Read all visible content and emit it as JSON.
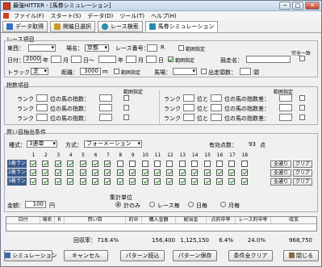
{
  "window": {
    "title": "最強HITTER - [馬券シミュレーション]",
    "minimize": "─",
    "maximize": "□",
    "close": "✕"
  },
  "menu": [
    "ファイル(F)",
    "スタート(S)",
    "データ(D)",
    "ツール(T)",
    "ヘルプ(H)"
  ],
  "tabs": [
    {
      "label": "データ取得",
      "color": "#3a70c0"
    },
    {
      "label": "開催日選択",
      "color": "#c89a2a"
    },
    {
      "label": "レース検索",
      "color": "#2a8ab0"
    },
    {
      "label": "馬券シミュレーション",
      "color": "#2a8ab0"
    }
  ],
  "race": {
    "section": "レース項目",
    "east_west_label": "東西：",
    "east_west_value": "",
    "place_label": "場名：",
    "place_value": "京都",
    "race_no_label": "レース番号：",
    "race_no_value": "",
    "race_no_unit": "R",
    "range_label": "範囲指定",
    "complete_match": "完全一致",
    "date_label": "日付：",
    "date_from_year": "2000",
    "year_unit": "年",
    "month_unit": "月",
    "day_unit": "日",
    "tilde": "日～",
    "date_to_year": "",
    "date_range_label": "範囲指定",
    "race_name_label": "競走名：",
    "race_name_value": "",
    "track_label": "トラック：",
    "track_value": "芝",
    "distance_label": "距離：",
    "distance_value": "3000",
    "distance_unit": "m",
    "condition_label": "馬場：",
    "condition_value": "",
    "runners_label": "出走頭数：",
    "runners_value": "",
    "runners_unit": "頭"
  },
  "index": {
    "section": "指数項目",
    "range_label": "範囲指定",
    "rank_label": "ランク",
    "left_suffix": "位の馬の指数：",
    "right_mid": "位と",
    "right_suffix": "位の馬の指数差：",
    "rows": [
      1,
      2,
      3
    ]
  },
  "buy": {
    "section": "買い目抽出条件",
    "kind_label": "種式：",
    "kind_value": "3連単",
    "method_label": "方式：",
    "method_value": "フォーメーション",
    "valid_label": "有効点数：",
    "valid_value": "93",
    "valid_unit": "点",
    "columns": [
      "1",
      "2",
      "3",
      "4",
      "5",
      "6",
      "7",
      "8",
      "9",
      "10",
      "11",
      "12",
      "13",
      "14",
      "15",
      "16",
      "17",
      "18"
    ],
    "rows": [
      {
        "label": "1着ランク",
        "checks": [
          1,
          1,
          1,
          1,
          1,
          1,
          1,
          0,
          0,
          0,
          0,
          0,
          0,
          0,
          0,
          0,
          0,
          0
        ]
      },
      {
        "label": "2着ランク",
        "checks": [
          1,
          1,
          1,
          1,
          1,
          1,
          1,
          1,
          1,
          1,
          1,
          1,
          1,
          1,
          1,
          1,
          1,
          1
        ]
      },
      {
        "label": "3着ランク",
        "checks": [
          1,
          1,
          1,
          1,
          1,
          1,
          1,
          1,
          1,
          1,
          1,
          1,
          1,
          1,
          1,
          1,
          1,
          1
        ]
      }
    ],
    "all_label": "全通り",
    "clear_label": "クリア",
    "amount_label": "金額：",
    "amount_value": "100",
    "amount_unit": "円",
    "agg_label": "集計単位",
    "agg_options": [
      "計のみ",
      "レース毎",
      "日毎",
      "月毎"
    ],
    "agg_selected": 0
  },
  "table": {
    "headers": [
      "日付",
      "場名",
      "R",
      "買い目",
      "的中",
      "購入金額",
      "配当金",
      "点的中率",
      "レース的中率",
      "収支"
    ]
  },
  "summary": {
    "recovery_label": "回収率：",
    "recovery_value": "718.4%",
    "purchase": "156,400",
    "payout": "1,125,150",
    "hit_rate": "6.4%",
    "race_hit_rate": "24.0%",
    "balance": "968,750"
  },
  "buttons": [
    "シミュレーション",
    "キャンセル",
    "パターン読込",
    "パターン保存",
    "条件全クリア",
    "閉じる"
  ]
}
